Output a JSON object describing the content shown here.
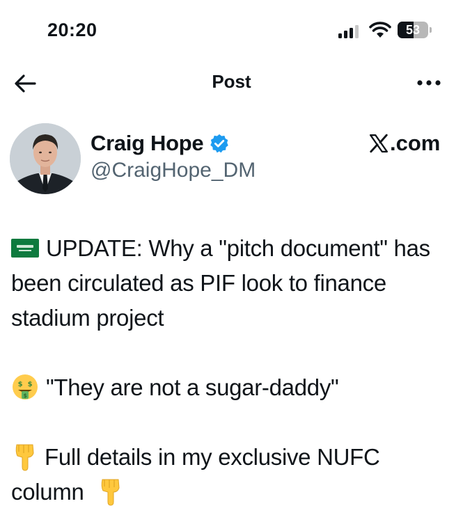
{
  "status_bar": {
    "time": "20:20",
    "battery_percent": "53",
    "battery_level": 0.53
  },
  "nav": {
    "title": "Post"
  },
  "author": {
    "display_name": "Craig Hope",
    "handle": "@CraigHope_DM",
    "verified": true
  },
  "source": {
    "label": ".com"
  },
  "post": {
    "lines": [
      {
        "emoji": "saudi-flag-icon",
        "text": "UPDATE: Why a \"pitch document\" has been circulated as PIF look to finance stadium project"
      },
      {
        "emoji": "money-mouth-face-icon",
        "text": "\"They are not a sugar-daddy\""
      },
      {
        "emoji": "backhand-index-pointing-down-icon",
        "text": "Full details in my exclusive NUFC column"
      }
    ]
  },
  "colors": {
    "text": "#0f1419",
    "secondary": "#536471",
    "verified": "#1d9bf0"
  }
}
